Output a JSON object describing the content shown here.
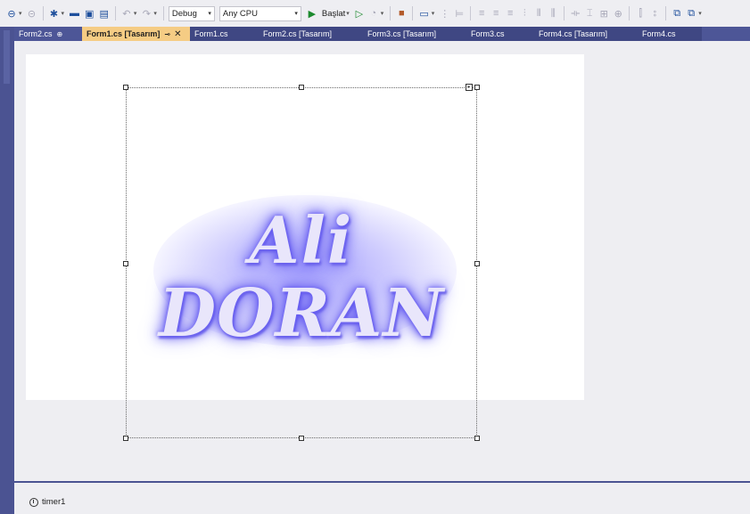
{
  "toolbar": {
    "back_icon": "back-arrow-icon",
    "forward_icon": "forward-arrow-icon",
    "config": "Debug",
    "platform": "Any CPU",
    "start_label": "Başlat"
  },
  "tabs": [
    {
      "label": "Form2.cs",
      "active": false
    },
    {
      "label": "Form1.cs [Tasarım]",
      "active": true
    },
    {
      "label": "Form1.cs",
      "active": false
    },
    {
      "label": "Form2.cs [Tasarım]",
      "active": false
    },
    {
      "label": "Form3.cs [Tasarım]",
      "active": false
    },
    {
      "label": "Form3.cs",
      "active": false
    },
    {
      "label": "Form4.cs [Tasarım]",
      "active": false
    },
    {
      "label": "Form4.cs",
      "active": false
    }
  ],
  "picture": {
    "line1": "Ali",
    "line2": "DORAN"
  },
  "tray": {
    "component": "timer1"
  },
  "colors": {
    "tab_active": "#f5cc84",
    "tab_bar": "#4d5697",
    "glow": "#5248ee"
  }
}
